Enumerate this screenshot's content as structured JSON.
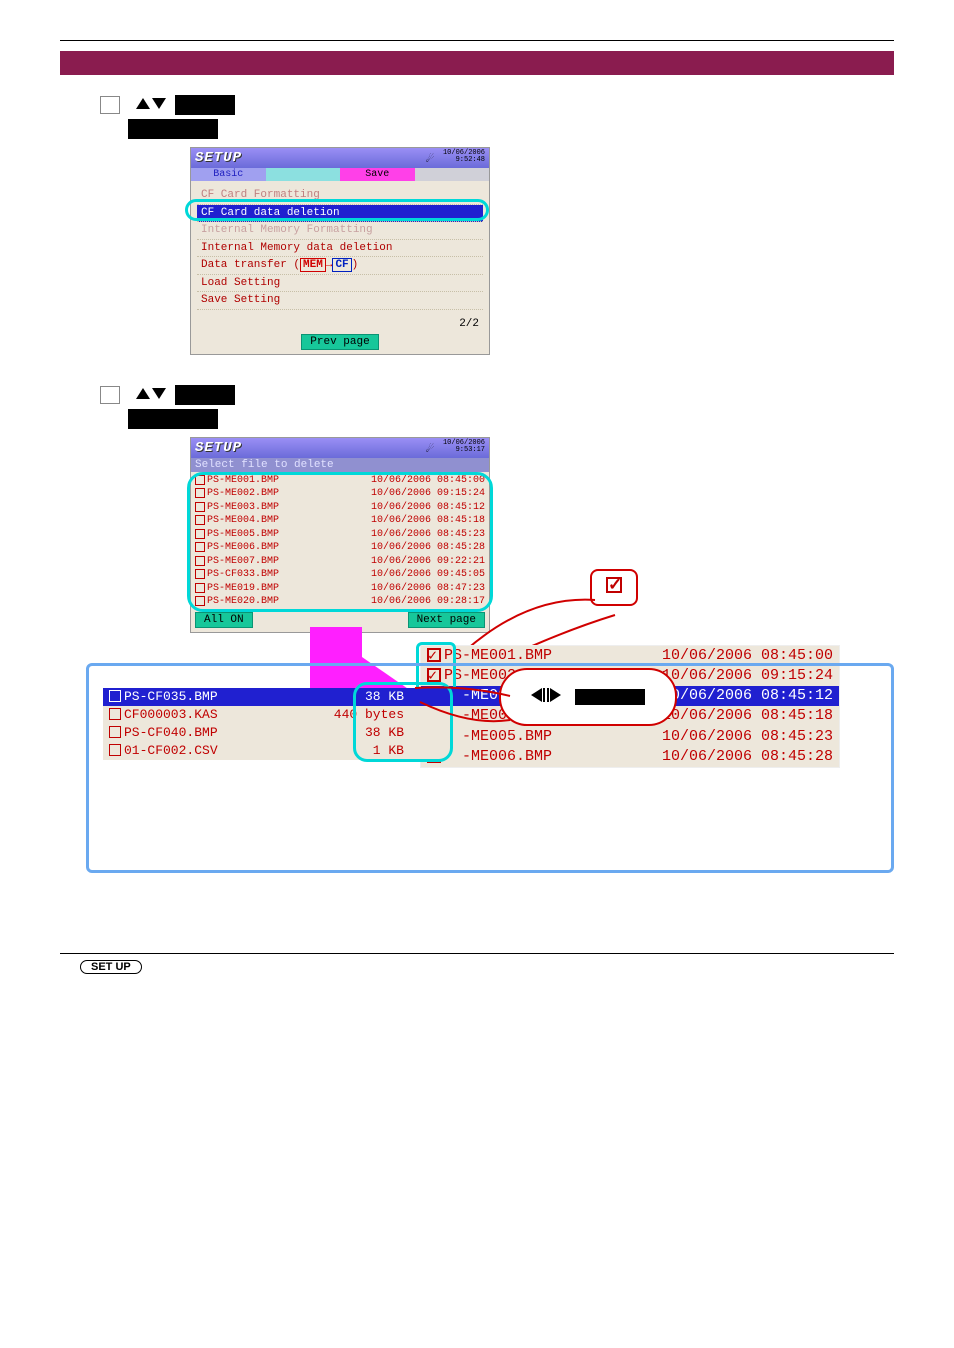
{
  "screen1": {
    "title": "SETUP",
    "date": "10/06/2006",
    "time": "9:52:48",
    "tabs": {
      "basic": "Basic",
      "func": "",
      "save": "Save",
      "other": ""
    },
    "items": {
      "i0": "CF Card Formatting",
      "i1": "CF Card data deletion",
      "i2": "Internal Memory Formatting",
      "i3": "Internal Memory data deletion",
      "i4_pre": "Data transfer (",
      "i4_mem": "MEM",
      "i4_arrow": "→",
      "i4_cf": "CF",
      "i4_post": ")",
      "i5": "Load Setting",
      "i6": "Save Setting"
    },
    "page_indicator": "2/2",
    "prev_btn": "Prev page"
  },
  "screen2": {
    "title": "SETUP",
    "date": "10/06/2006",
    "time": "9:53:17",
    "subheader": "Select file to delete",
    "files": [
      {
        "name": "PS-ME001.BMP",
        "dt": "10/06/2006 08:45:00"
      },
      {
        "name": "PS-ME002.BMP",
        "dt": "10/06/2006 09:15:24"
      },
      {
        "name": "PS-ME003.BMP",
        "dt": "10/06/2006 08:45:12"
      },
      {
        "name": "PS-ME004.BMP",
        "dt": "10/06/2006 08:45:18"
      },
      {
        "name": "PS-ME005.BMP",
        "dt": "10/06/2006 08:45:23"
      },
      {
        "name": "PS-ME006.BMP",
        "dt": "10/06/2006 08:45:28"
      },
      {
        "name": "PS-ME007.BMP",
        "dt": "10/06/2006 09:22:21"
      },
      {
        "name": "PS-CF033.BMP",
        "dt": "10/06/2006 09:45:05"
      },
      {
        "name": "PS-ME019.BMP",
        "dt": "10/06/2006 08:47:23"
      },
      {
        "name": "PS-ME020.BMP",
        "dt": "10/06/2006 09:28:17"
      }
    ],
    "all_on_btn": "All ON",
    "next_btn": "Next page"
  },
  "preview": {
    "rows": [
      {
        "name": "PS-ME001.BMP",
        "dt": "10/06/2006 08:45:00",
        "checked": true,
        "sel": false
      },
      {
        "name": "PS-ME002.BMP",
        "dt": "10/06/2006 09:15:24",
        "checked": true,
        "sel": false
      },
      {
        "name": "PS-ME003.BMP",
        "dt": "10/06/2006 08:45:12",
        "checked": true,
        "sel": true
      },
      {
        "name": "PS-ME004.BMP",
        "dt": "10/06/2006 08:45:18",
        "checked": false,
        "sel": false
      },
      {
        "name": "PS-ME005.BMP",
        "dt": "10/06/2006 08:45:23",
        "checked": false,
        "sel": false
      },
      {
        "name": "PS-ME006.BMP",
        "dt": "10/06/2006 08:45:28",
        "checked": false,
        "sel": false
      }
    ]
  },
  "note": {
    "rows": [
      {
        "name": "PS-CF035.BMP",
        "size": "38 KB",
        "sel": true
      },
      {
        "name": "CF000003.KAS",
        "size": "440 bytes",
        "sel": false
      },
      {
        "name": "PS-CF040.BMP",
        "size": "38 KB",
        "sel": false
      },
      {
        "name": "01-CF002.CSV",
        "size": "1 KB",
        "sel": false
      }
    ]
  },
  "footer": {
    "setup_label": "SET UP"
  }
}
